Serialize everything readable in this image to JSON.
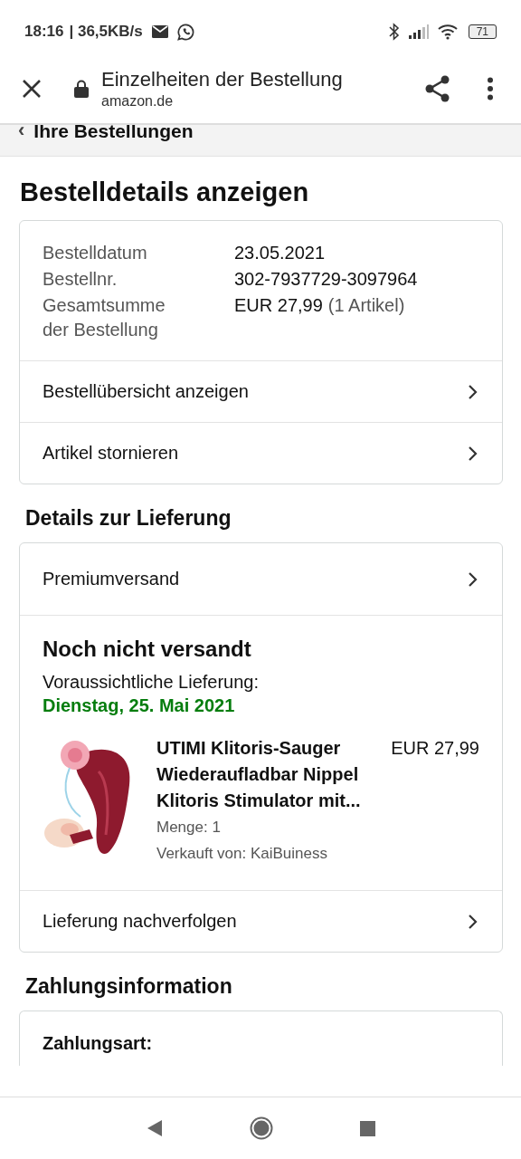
{
  "status_bar": {
    "time": "18:16",
    "speed": "| 36,5KB/s",
    "battery": "71"
  },
  "toolbar": {
    "title": "Einzelheiten der Bestellung",
    "url": "amazon.de"
  },
  "breadcrumb": {
    "chevron": "‹",
    "label": "Ihre Bestellungen"
  },
  "page_title": "Bestelldetails anzeigen",
  "order_summary": {
    "fields": [
      {
        "label": "Bestelldatum",
        "value": "23.05.2021"
      },
      {
        "label": "Bestellnr.",
        "value": "302-7937729-3097964"
      },
      {
        "label": "Gesamtsumme der Bestellung",
        "value": "EUR 27,99",
        "note": "(1 Artikel)"
      }
    ],
    "links": [
      "Bestellübersicht anzeigen",
      "Artikel stornieren"
    ]
  },
  "delivery": {
    "heading": "Details zur Lieferung",
    "shipping_method": "Premiumversand",
    "status": "Noch nicht versandt",
    "expected_label": "Voraussichtliche Lieferung:",
    "expected_date": "Dienstag, 25. Mai 2021",
    "item": {
      "kind": "picture",
      "title": "UTIMI Klitoris-Sauger Wiederaufladbar Nippel Klitoris Stimulator mit...",
      "price": "EUR 27,99",
      "quantity": "Menge: 1",
      "seller": "Verkauft von: KaiBuiness"
    },
    "track_link": "Lieferung nachverfolgen"
  },
  "payment": {
    "heading": "Zahlungsinformation",
    "label": "Zahlungsart:"
  }
}
